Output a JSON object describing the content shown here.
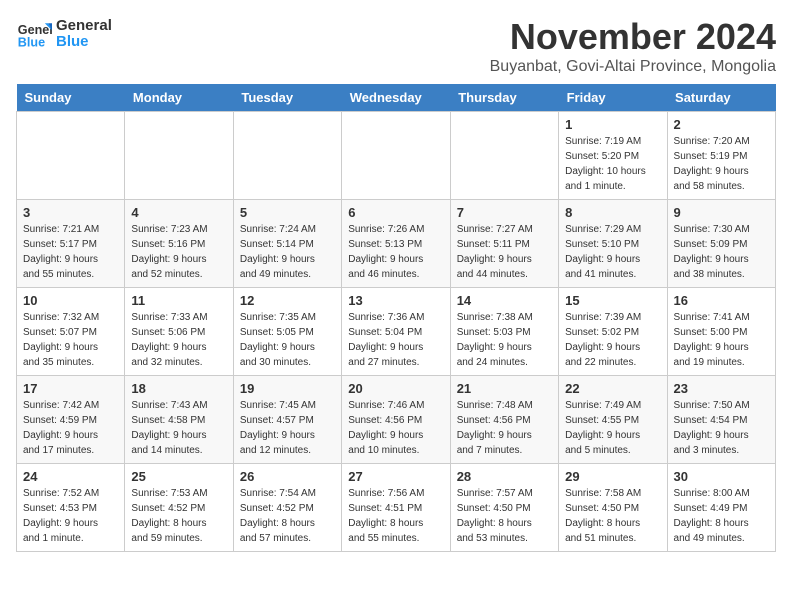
{
  "header": {
    "logo_line1": "General",
    "logo_line2": "Blue",
    "month_title": "November 2024",
    "location": "Buyanbat, Govi-Altai Province, Mongolia"
  },
  "weekdays": [
    "Sunday",
    "Monday",
    "Tuesday",
    "Wednesday",
    "Thursday",
    "Friday",
    "Saturday"
  ],
  "weeks": [
    [
      {
        "day": "",
        "info": ""
      },
      {
        "day": "",
        "info": ""
      },
      {
        "day": "",
        "info": ""
      },
      {
        "day": "",
        "info": ""
      },
      {
        "day": "",
        "info": ""
      },
      {
        "day": "1",
        "info": "Sunrise: 7:19 AM\nSunset: 5:20 PM\nDaylight: 10 hours\nand 1 minute."
      },
      {
        "day": "2",
        "info": "Sunrise: 7:20 AM\nSunset: 5:19 PM\nDaylight: 9 hours\nand 58 minutes."
      }
    ],
    [
      {
        "day": "3",
        "info": "Sunrise: 7:21 AM\nSunset: 5:17 PM\nDaylight: 9 hours\nand 55 minutes."
      },
      {
        "day": "4",
        "info": "Sunrise: 7:23 AM\nSunset: 5:16 PM\nDaylight: 9 hours\nand 52 minutes."
      },
      {
        "day": "5",
        "info": "Sunrise: 7:24 AM\nSunset: 5:14 PM\nDaylight: 9 hours\nand 49 minutes."
      },
      {
        "day": "6",
        "info": "Sunrise: 7:26 AM\nSunset: 5:13 PM\nDaylight: 9 hours\nand 46 minutes."
      },
      {
        "day": "7",
        "info": "Sunrise: 7:27 AM\nSunset: 5:11 PM\nDaylight: 9 hours\nand 44 minutes."
      },
      {
        "day": "8",
        "info": "Sunrise: 7:29 AM\nSunset: 5:10 PM\nDaylight: 9 hours\nand 41 minutes."
      },
      {
        "day": "9",
        "info": "Sunrise: 7:30 AM\nSunset: 5:09 PM\nDaylight: 9 hours\nand 38 minutes."
      }
    ],
    [
      {
        "day": "10",
        "info": "Sunrise: 7:32 AM\nSunset: 5:07 PM\nDaylight: 9 hours\nand 35 minutes."
      },
      {
        "day": "11",
        "info": "Sunrise: 7:33 AM\nSunset: 5:06 PM\nDaylight: 9 hours\nand 32 minutes."
      },
      {
        "day": "12",
        "info": "Sunrise: 7:35 AM\nSunset: 5:05 PM\nDaylight: 9 hours\nand 30 minutes."
      },
      {
        "day": "13",
        "info": "Sunrise: 7:36 AM\nSunset: 5:04 PM\nDaylight: 9 hours\nand 27 minutes."
      },
      {
        "day": "14",
        "info": "Sunrise: 7:38 AM\nSunset: 5:03 PM\nDaylight: 9 hours\nand 24 minutes."
      },
      {
        "day": "15",
        "info": "Sunrise: 7:39 AM\nSunset: 5:02 PM\nDaylight: 9 hours\nand 22 minutes."
      },
      {
        "day": "16",
        "info": "Sunrise: 7:41 AM\nSunset: 5:00 PM\nDaylight: 9 hours\nand 19 minutes."
      }
    ],
    [
      {
        "day": "17",
        "info": "Sunrise: 7:42 AM\nSunset: 4:59 PM\nDaylight: 9 hours\nand 17 minutes."
      },
      {
        "day": "18",
        "info": "Sunrise: 7:43 AM\nSunset: 4:58 PM\nDaylight: 9 hours\nand 14 minutes."
      },
      {
        "day": "19",
        "info": "Sunrise: 7:45 AM\nSunset: 4:57 PM\nDaylight: 9 hours\nand 12 minutes."
      },
      {
        "day": "20",
        "info": "Sunrise: 7:46 AM\nSunset: 4:56 PM\nDaylight: 9 hours\nand 10 minutes."
      },
      {
        "day": "21",
        "info": "Sunrise: 7:48 AM\nSunset: 4:56 PM\nDaylight: 9 hours\nand 7 minutes."
      },
      {
        "day": "22",
        "info": "Sunrise: 7:49 AM\nSunset: 4:55 PM\nDaylight: 9 hours\nand 5 minutes."
      },
      {
        "day": "23",
        "info": "Sunrise: 7:50 AM\nSunset: 4:54 PM\nDaylight: 9 hours\nand 3 minutes."
      }
    ],
    [
      {
        "day": "24",
        "info": "Sunrise: 7:52 AM\nSunset: 4:53 PM\nDaylight: 9 hours\nand 1 minute."
      },
      {
        "day": "25",
        "info": "Sunrise: 7:53 AM\nSunset: 4:52 PM\nDaylight: 8 hours\nand 59 minutes."
      },
      {
        "day": "26",
        "info": "Sunrise: 7:54 AM\nSunset: 4:52 PM\nDaylight: 8 hours\nand 57 minutes."
      },
      {
        "day": "27",
        "info": "Sunrise: 7:56 AM\nSunset: 4:51 PM\nDaylight: 8 hours\nand 55 minutes."
      },
      {
        "day": "28",
        "info": "Sunrise: 7:57 AM\nSunset: 4:50 PM\nDaylight: 8 hours\nand 53 minutes."
      },
      {
        "day": "29",
        "info": "Sunrise: 7:58 AM\nSunset: 4:50 PM\nDaylight: 8 hours\nand 51 minutes."
      },
      {
        "day": "30",
        "info": "Sunrise: 8:00 AM\nSunset: 4:49 PM\nDaylight: 8 hours\nand 49 minutes."
      }
    ]
  ]
}
